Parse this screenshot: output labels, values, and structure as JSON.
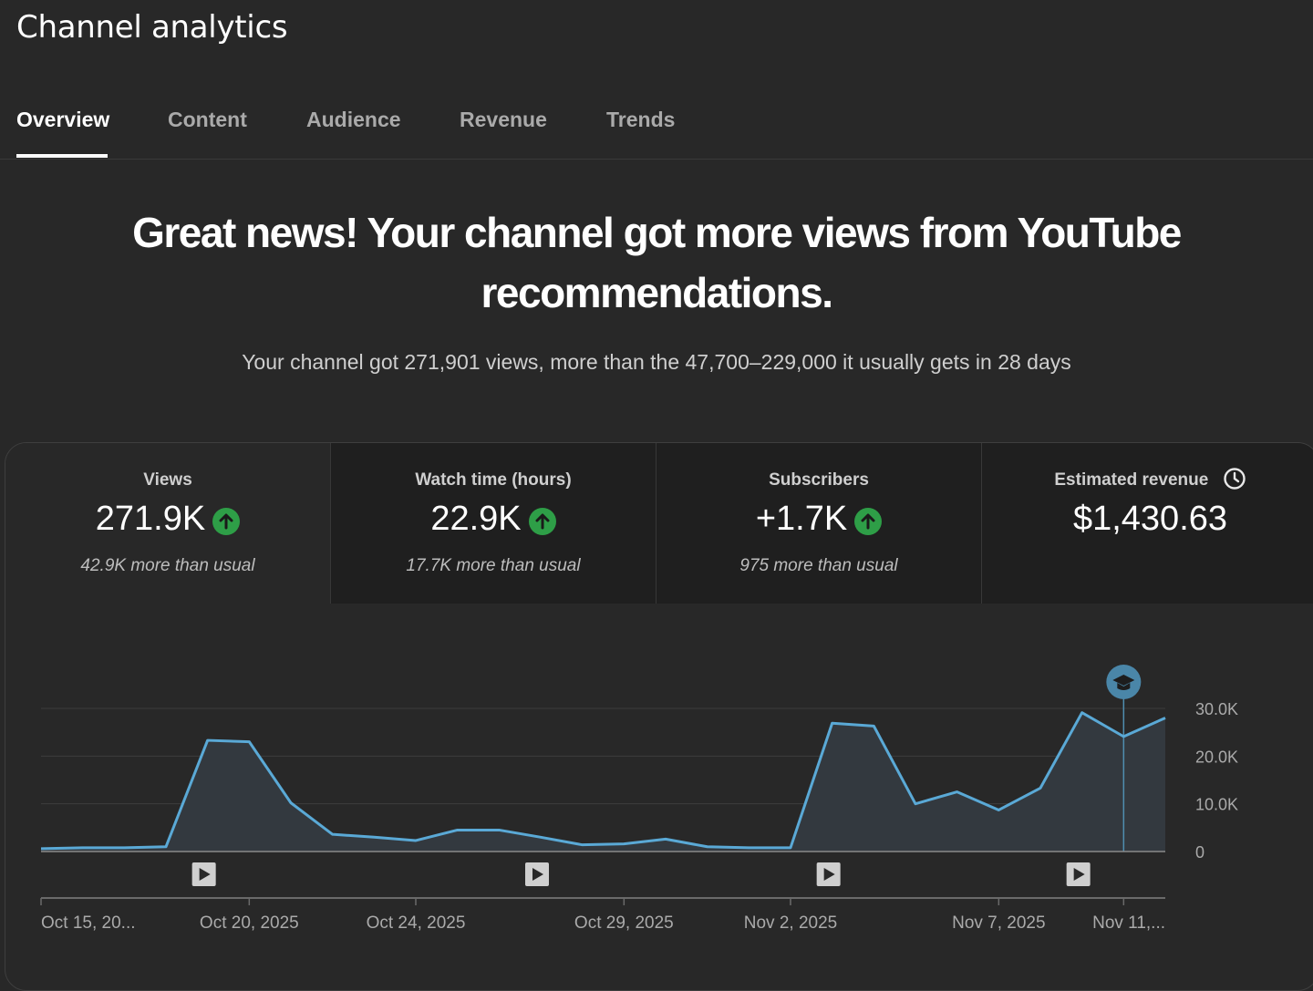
{
  "header": {
    "title": "Channel analytics"
  },
  "tabs": [
    {
      "label": "Overview",
      "active": true
    },
    {
      "label": "Content"
    },
    {
      "label": "Audience"
    },
    {
      "label": "Revenue"
    },
    {
      "label": "Trends"
    }
  ],
  "insight": {
    "headline": "Great news! Your channel got more views from YouTube recommendations.",
    "summary": "Your channel got 271,901 views, more than the 47,700–229,000 it usually gets in 28 days"
  },
  "metrics": [
    {
      "label": "Views",
      "value": "271.9K",
      "note": "42.9K more than usual",
      "trend_icon": "arrow-up-circle-icon",
      "active": true
    },
    {
      "label": "Watch time (hours)",
      "value": "22.9K",
      "note": "17.7K more than usual",
      "trend_icon": "arrow-up-circle-icon"
    },
    {
      "label": "Subscribers",
      "value": "+1.7K",
      "note": "975 more than usual",
      "trend_icon": "arrow-up-circle-icon"
    },
    {
      "label": "Estimated revenue",
      "value": "$1,430.63",
      "info_icon": "clock-icon"
    }
  ],
  "colors": {
    "accent_line": "#5aa9d6",
    "trend_up": "#2e9e47",
    "background": "#282828",
    "card_inactive": "#1f1f1f"
  },
  "chart_data": {
    "type": "area",
    "series": [
      {
        "values": [
          600,
          800,
          800,
          1000,
          23300,
          23000,
          10200,
          3600,
          3000,
          2300,
          4500,
          4500,
          3000,
          1400,
          1600,
          2600,
          1000,
          800,
          800,
          26900,
          26300,
          10000,
          12500,
          8700,
          13300,
          29100,
          24100,
          28000
        ]
      }
    ],
    "x_tick_labels": [
      "Oct 15, 20...",
      "Oct 20, 2025",
      "Oct 24, 2025",
      "Oct 29, 2025",
      "Nov 2, 2025",
      "Nov 7, 2025",
      "Nov 11,..."
    ],
    "y_tick_labels": [
      "30.0K",
      "20.0K",
      "10.0K",
      "0"
    ],
    "ylim": [
      0,
      30000
    ],
    "grid": true,
    "video_markers": [
      4,
      12,
      19,
      25
    ],
    "highlight_index": 26,
    "highlight_icon": "graduation-cap-icon",
    "marker_icon": "play-icon"
  }
}
